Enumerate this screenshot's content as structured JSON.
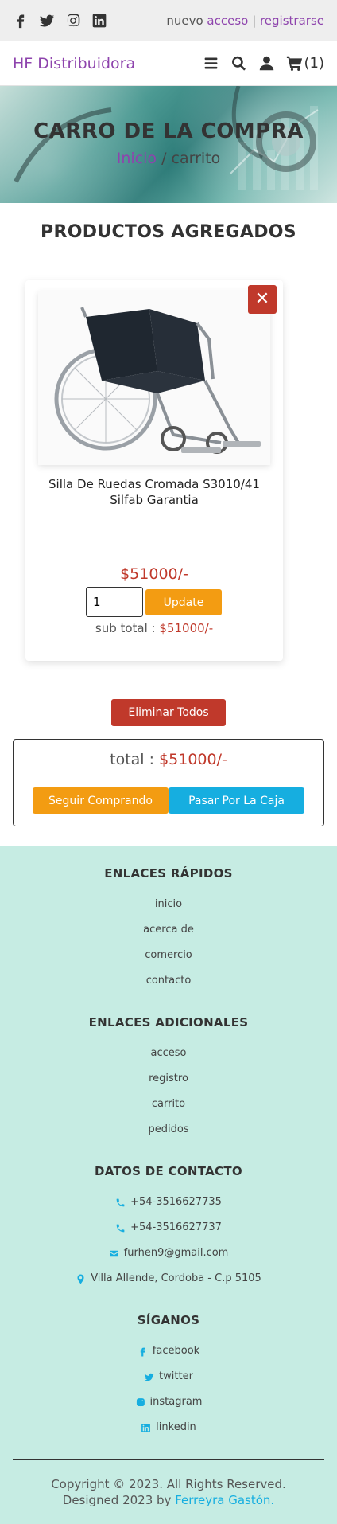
{
  "topbar": {
    "social": [
      "facebook-icon",
      "twitter-icon",
      "instagram-icon",
      "linkedin-icon"
    ],
    "auth_prefix": "nuevo",
    "login": "acceso",
    "separator": "|",
    "register": "registrarse"
  },
  "header": {
    "logo": "HF Distribuidora",
    "cart_count": "(1)"
  },
  "hero": {
    "title": "CARRO DE LA COMPRA",
    "crumb_home": "Inicio",
    "crumb_current": "/ carrito"
  },
  "products": {
    "section_title": "PRODUCTOS AGREGADOS",
    "items": [
      {
        "name": "Silla De Ruedas Cromada S3010/41 Silfab Garantia",
        "price": "$51000/-",
        "quantity": "1",
        "update_label": "Update",
        "subtotal_label": "sub total :",
        "subtotal_value": "$51000/-",
        "remove_label": "✕"
      }
    ],
    "delete_all_label": "Eliminar Todos"
  },
  "summary": {
    "total_label": "total :",
    "total_value": "$51000/-",
    "continue_label": "Seguir Comprando",
    "checkout_label": "Pasar Por La Caja"
  },
  "footer": {
    "quick_links": {
      "title": "ENLACES RÁPIDOS",
      "items": [
        "inicio",
        "acerca de",
        "comercio",
        "contacto"
      ]
    },
    "extra_links": {
      "title": "ENLACES ADICIONALES",
      "items": [
        "acceso",
        "registro",
        "carrito",
        "pedidos"
      ]
    },
    "contact": {
      "title": "DATOS DE CONTACTO",
      "phone1": "+54-3516627735",
      "phone2": "+54-3516627737",
      "email": "furhen9@gmail.com",
      "address": "Villa Allende, Cordoba - C.p 5105"
    },
    "follow": {
      "title": "SÍGANOS",
      "items": [
        "facebook",
        "twitter",
        "instagram",
        "linkedin"
      ]
    },
    "copyright": "Copyright © 2023. All Rights Reserved. Designed 2023 by",
    "author": "Ferreyra Gastón."
  },
  "colors": {
    "brand": "#8e44ad",
    "danger": "#c0392b",
    "warning": "#f39c12",
    "info": "#16aee0",
    "footer_bg": "#c6ece3"
  }
}
